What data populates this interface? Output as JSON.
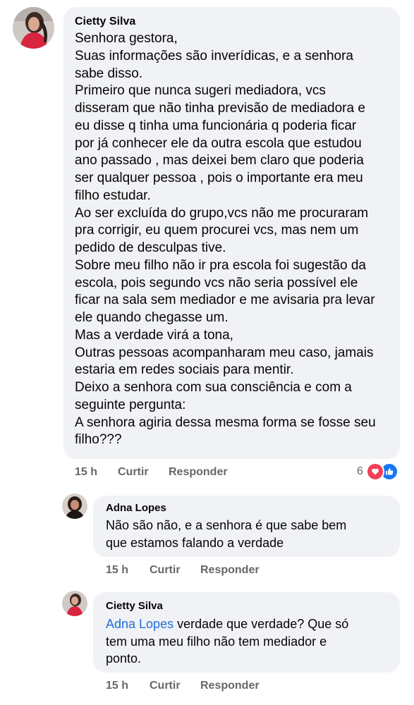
{
  "comment_main": {
    "author": "Cietty Silva",
    "lines": [
      "Senhora gestora,",
      "Suas informações são inverídicas,  e a senhora",
      "sabe disso.",
      "Primeiro que nunca sugeri mediadora, vcs",
      "disseram que não tinha previsão de mediadora e",
      "eu disse q tinha uma funcionária q poderia ficar",
      "por já conhecer ele da outra escola que estudou",
      "ano passado , mas deixei bem claro que poderia",
      "ser qualquer pessoa , pois o importante era meu",
      "filho estudar.",
      "Ao ser excluída do grupo,vcs não me procuraram",
      "pra corrigir,  eu quem  procurei vcs, mas nem um",
      "pedido de desculpas tive.",
      "Sobre meu filho não ir pra escola foi sugestão da",
      "escola, pois segundo vcs não seria possível ele",
      "ficar na sala sem mediador e me avisaria pra levar",
      "ele quando chegasse um.",
      "Mas a verdade virá a tona,",
      "Outras pessoas acompanharam meu caso, jamais",
      "estaria em redes sociais para mentir.",
      "Deixo a senhora com sua consciência e com a",
      "seguinte pergunta:",
      "A senhora agiria dessa mesma forma se fosse seu",
      "filho???"
    ],
    "time": "15 h",
    "like_label": "Curtir",
    "reply_label": "Responder",
    "reaction_count": "6",
    "reaction_icons": [
      "love-icon",
      "like-icon"
    ]
  },
  "reply_1": {
    "author": "Adna Lopes",
    "lines": [
      "Não são não, e a senhora é que sabe bem",
      "que estamos falando a verdade"
    ],
    "time": "15 h",
    "like_label": "Curtir",
    "reply_label": "Responder"
  },
  "reply_2": {
    "author": "Cietty Silva",
    "mention": "Adna Lopes",
    "line1_rest": " verdade que verdade? Que só",
    "lines": [
      "tem uma meu filho não tem mediador e",
      "ponto."
    ],
    "time": "15 h",
    "like_label": "Curtir",
    "reply_label": "Responder"
  },
  "colors": {
    "bubble": "#f0f2f5",
    "text": "#050505",
    "secondary": "#65676b",
    "mention": "#216fdb",
    "love": "#f33e58",
    "like": "#1877f2"
  }
}
